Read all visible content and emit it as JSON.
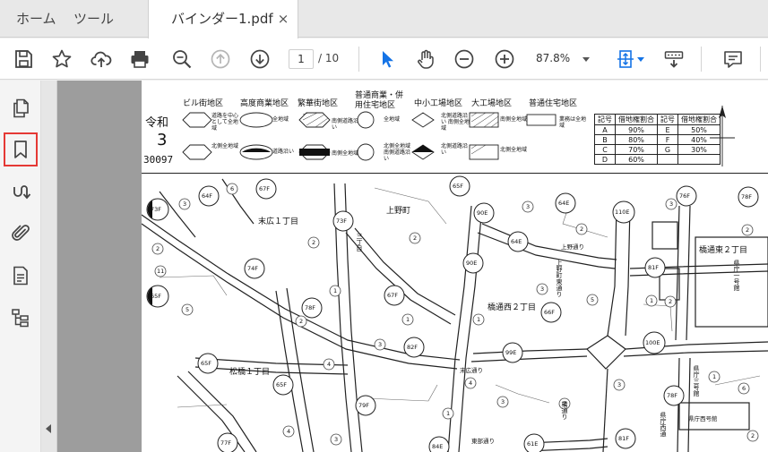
{
  "tabs": {
    "home": "ホーム",
    "tools": "ツール",
    "document": "バインダー1.pdf",
    "close": "×"
  },
  "toolbar": {
    "icons": [
      "save-icon",
      "bookmark-star-icon",
      "upload-icon",
      "print-icon",
      "zoom-search-icon",
      "page-up-icon",
      "page-down-icon",
      "zoom-out-icon",
      "zoom-in-icon",
      "select-arrow-icon",
      "hand-icon",
      "fit-page-icon",
      "keyboard-icon",
      "comment-icon"
    ],
    "page_current": "1",
    "page_total": "/ 10",
    "zoom": "87.8%"
  },
  "sidebar": {
    "icons": [
      "pages-icon",
      "bookmark-icon",
      "signature-icon",
      "attachment-icon",
      "document-properties-icon",
      "content-tree-icon"
    ],
    "active": "bookmark-icon"
  },
  "colors": {
    "accent": "#1473e6",
    "active_border": "#e53935",
    "doc_background": "#9d9d9d"
  },
  "document": {
    "legend": {
      "era": "令和",
      "era_year": "3",
      "code": "30097",
      "districts": [
        "ビル街地区",
        "高度商業地区",
        "繁華街地区",
        "普通商業・併用住宅地区",
        "中小工場地区",
        "大工場地区",
        "普通住宅地区"
      ],
      "notes": {
        "n1": "道路を中心として全地域",
        "n2": "北側全地域",
        "n3": "全地域",
        "n4": "道路沿い",
        "n5": "南側道路沿い",
        "n6": "南側全地域",
        "n7": "全地域",
        "n8": "北側全地域 南側道路沿い",
        "n9": "北側道路沿い 南側全地域",
        "n10": "北側道路沿い",
        "n11": "南側全地域",
        "n12": "北側全地域",
        "n13": "業務は全地域"
      },
      "table": {
        "header_symbol": "記号",
        "header_ratio": "借地権割合",
        "rows": [
          {
            "s1": "A",
            "r1": "90%",
            "s2": "E",
            "r2": "50%"
          },
          {
            "s1": "B",
            "r1": "80%",
            "s2": "F",
            "r2": "40%"
          },
          {
            "s1": "C",
            "r1": "70%",
            "s2": "G",
            "r2": "30%"
          },
          {
            "s1": "D",
            "r1": "60%",
            "s2": "",
            "r2": ""
          }
        ]
      }
    },
    "map": {
      "areas": {
        "suehiro": "末広１丁目",
        "ueno": "上野町",
        "hashidoori_nishi": "橋通西２丁目",
        "hashidoori_higashi": "橋通東２丁目",
        "matsubashi": "松橋１丁目",
        "kencho_nishi": "県庁西号館",
        "ken_ichigo": "県庁一号館",
        "ken_sango": "県庁三号館",
        "ken_nishi_dori": "県庁西通",
        "suehiro_dori": "末広通り",
        "ueno_dori": "上野通り",
        "ueno_machi_dori": "上野町東通り",
        "hashidoori": "橋通り",
        "kita_ichi": "東部通り",
        "sanki": "三丁目"
      },
      "route_labels": [
        "64F",
        "67F",
        "73F",
        "65F",
        "90E",
        "64E",
        "110E",
        "76F",
        "78F",
        "73F",
        "65F",
        "74F",
        "78F",
        "67F",
        "90E",
        "64E",
        "81F",
        "82F",
        "99E",
        "100E",
        "65F",
        "65F",
        "79F",
        "78F",
        "77F",
        "84E",
        "61E",
        "81F",
        "66F"
      ],
      "block_numbers": [
        "3",
        "6",
        "2",
        "2",
        "3",
        "2",
        "3",
        "2",
        "2",
        "11",
        "1",
        "5",
        "1",
        "2",
        "1",
        "3",
        "5",
        "1",
        "2",
        "4",
        "4",
        "3",
        "3",
        "1",
        "4",
        "3",
        "2",
        "3",
        "1",
        "6",
        "2"
      ]
    }
  }
}
